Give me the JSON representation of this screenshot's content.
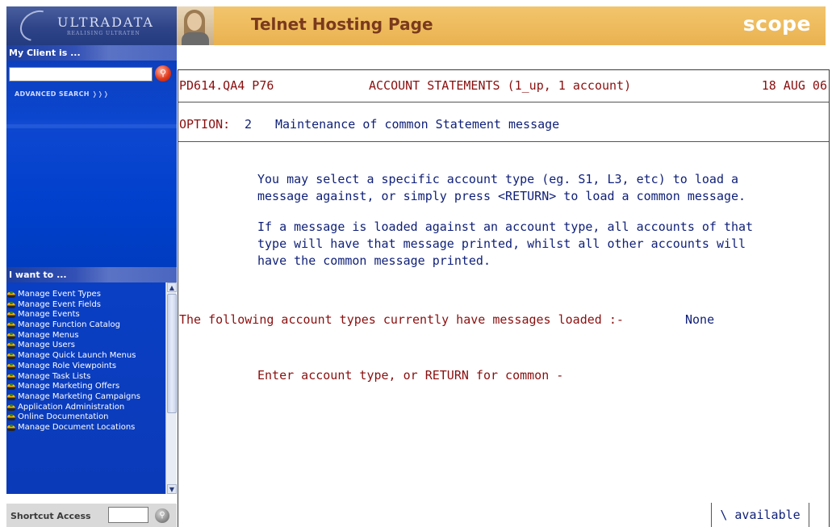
{
  "sidebar": {
    "logo_brand": "ULTRADATA",
    "logo_tagline": "REALISING ULTRATEN",
    "client_label": "My Client is ...",
    "client_input_value": "",
    "advanced_search": "ADVANCED SEARCH",
    "iwant_label": "I want to ...",
    "menu_items": [
      "Manage Event Types",
      "Manage Event Fields",
      "Manage Events",
      "Manage Function Catalog",
      "Manage Menus",
      "Manage Users",
      "Manage Quick Launch Menus",
      "Manage Role Viewpoints",
      "Manage Task Lists",
      "Manage Marketing Offers",
      "Manage Marketing Campaigns",
      "Application Administration",
      "Online Documentation",
      "Manage Document Locations"
    ],
    "shortcut_label": "Shortcut Access",
    "shortcut_value": ""
  },
  "header": {
    "title": "Telnet Hosting Page",
    "brand": "scope"
  },
  "terminal": {
    "program": "PD614.QA4 P76",
    "screen_title": "ACCOUNT STATEMENTS (1_up, 1 account)",
    "date": "18 AUG 06",
    "option_label": "OPTION:",
    "option_number": "2",
    "option_text": "Maintenance of common Statement message",
    "para1_line1": "You may select a specific account type (eg. S1, L3, etc) to load a",
    "para1_line2": "message against, or simply press <RETURN> to load a common message.",
    "para2_line1": "If a message is loaded against an account type, all accounts of that",
    "para2_line2": "type will have that message printed, whilst all other accounts will",
    "para2_line3": "have the common message printed.",
    "loaded_label": "The following account types currently have messages loaded :-",
    "loaded_value": "None",
    "prompt": "Enter account type, or RETURN for common -",
    "status": "\\ available"
  },
  "colors": {
    "terminal_red": "#8a0f0f",
    "terminal_navy": "#0e1f78",
    "sidebar_blue": "#0b46cf",
    "header_gold": "#eebc5e"
  }
}
